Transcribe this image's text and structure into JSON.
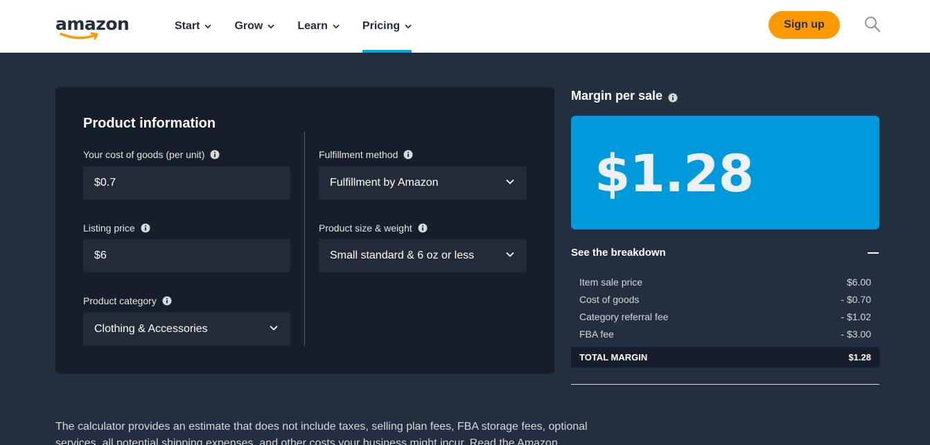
{
  "header": {
    "logo_text": "amazon",
    "nav": [
      {
        "label": "Start"
      },
      {
        "label": "Grow"
      },
      {
        "label": "Learn"
      },
      {
        "label": "Pricing"
      }
    ],
    "signup_label": "Sign up"
  },
  "product": {
    "title": "Product information",
    "cost_label": "Your cost of goods (per unit)",
    "cost_value": "$0.7",
    "price_label": "Listing price",
    "price_value": "$6",
    "category_label": "Product category",
    "category_value": "Clothing & Accessories",
    "fulfillment_label": "Fulfillment method",
    "fulfillment_value": "Fulfillment by Amazon",
    "size_label": "Product size & weight",
    "size_value": "Small standard & 6 oz or less"
  },
  "result": {
    "title": "Margin per sale",
    "value": "$1.28",
    "breakdown_label": "See the breakdown",
    "rows": [
      {
        "label": "Item sale price",
        "value": "$6.00"
      },
      {
        "label": "Cost of goods",
        "value": "- $0.70"
      },
      {
        "label": "Category referral fee",
        "value": "- $1.02"
      },
      {
        "label": "FBA fee",
        "value": "- $3.00"
      }
    ],
    "total_label": "TOTAL MARGIN",
    "total_value": "$1.28"
  },
  "disclaimer": "The calculator provides an estimate that does not include taxes, selling plan fees, FBA storage fees, optional services, all potential shipping expenses, and other costs your business might incur. Read the Amazon",
  "colors": {
    "accent": "#00a8e1",
    "signup": "#ff9900",
    "margin_box": "#0099d9",
    "background": "#232f3e",
    "card": "#161d2b"
  }
}
